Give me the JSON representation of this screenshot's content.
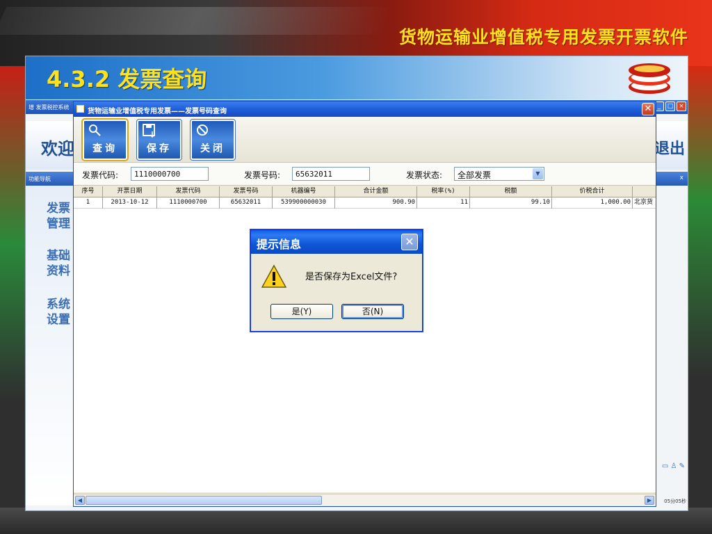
{
  "slide": {
    "banner_title": "货物运输业增值税专用发票开票软件",
    "section_title": "4.3.2 发票查询"
  },
  "background_app": {
    "title": "增 发票税控系统",
    "welcome_text": "欢迎",
    "exit_text": "退出",
    "nav_label": "功能导航",
    "nav_close": "x",
    "sidebar_items": [
      "发票管理",
      "基础资料",
      "系统设置"
    ],
    "status_text": "05分05秒"
  },
  "query_window": {
    "title": "货物运输业增值税专用发票——发票号码查询",
    "close_glyph": "✕",
    "toolbar": {
      "query_label": "查询",
      "save_label": "保存",
      "close_label": "关闭"
    },
    "filters": {
      "code_label": "发票代码:",
      "code_value": "1110000700",
      "number_label": "发票号码:",
      "number_value": "65632011",
      "status_label": "发票状态:",
      "status_value": "全部发票"
    },
    "table": {
      "columns": [
        "序号",
        "开票日期",
        "发票代码",
        "发票号码",
        "机器编号",
        "合计金额",
        "税率(%)",
        "税额",
        "价税合计",
        ""
      ],
      "rows": [
        [
          "1",
          "2013-10-12",
          "1110000700",
          "65632011",
          "539900000030",
          "900.90",
          "11",
          "99.10",
          "1,000.00",
          "北京货"
        ]
      ]
    }
  },
  "dialog": {
    "title": "提示信息",
    "message": "是否保存为Excel文件?",
    "yes_label": "是(Y)",
    "no_label": "否(N)",
    "close_glyph": "✕"
  },
  "colors": {
    "titlebar_blue": "#1f5fd8",
    "banner_yellow": "#ffe21a",
    "window_bg": "#ece9d8"
  }
}
